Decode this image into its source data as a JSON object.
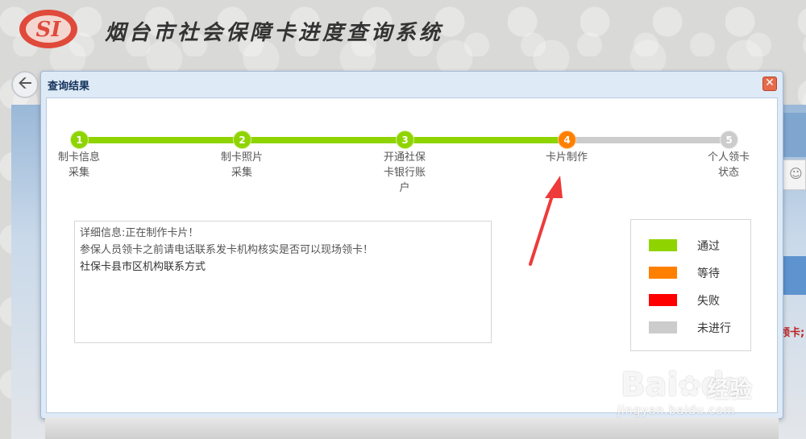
{
  "header": {
    "site_title": "烟台市社会保障卡进度查询系统",
    "logo_text": "SI",
    "logo_color": "#e04a3a"
  },
  "dialog": {
    "title": "查询结果",
    "close_icon": "close-icon"
  },
  "progress": {
    "steps": [
      {
        "number": "1",
        "label": "制卡信息采集",
        "status": "pass"
      },
      {
        "number": "2",
        "label": "制卡照片采集",
        "status": "pass"
      },
      {
        "number": "3",
        "label": "开通社保卡银行账户",
        "status": "pass"
      },
      {
        "number": "4",
        "label": "卡片制作",
        "status": "waiting"
      },
      {
        "number": "5",
        "label": "个人领卡状态",
        "status": "not-started"
      }
    ]
  },
  "details": {
    "line1": "详细信息:正在制作卡片！",
    "line2": "参保人员领卡之前请电话联系发卡机构核实是否可以现场领卡！",
    "line3": "社保卡县市区机构联系方式"
  },
  "legend": [
    {
      "label": "通过",
      "color": "#8fd400"
    },
    {
      "label": "等待",
      "color": "#ff7f00"
    },
    {
      "label": "失败",
      "color": "#ff0000"
    },
    {
      "label": "未进行",
      "color": "#cccccc"
    }
  ],
  "background": {
    "right_text": "领卡;"
  },
  "watermark": {
    "brand": "Bai",
    "brand2": "du",
    "cn": "经验",
    "sub": "jingyan.baidu.com"
  }
}
